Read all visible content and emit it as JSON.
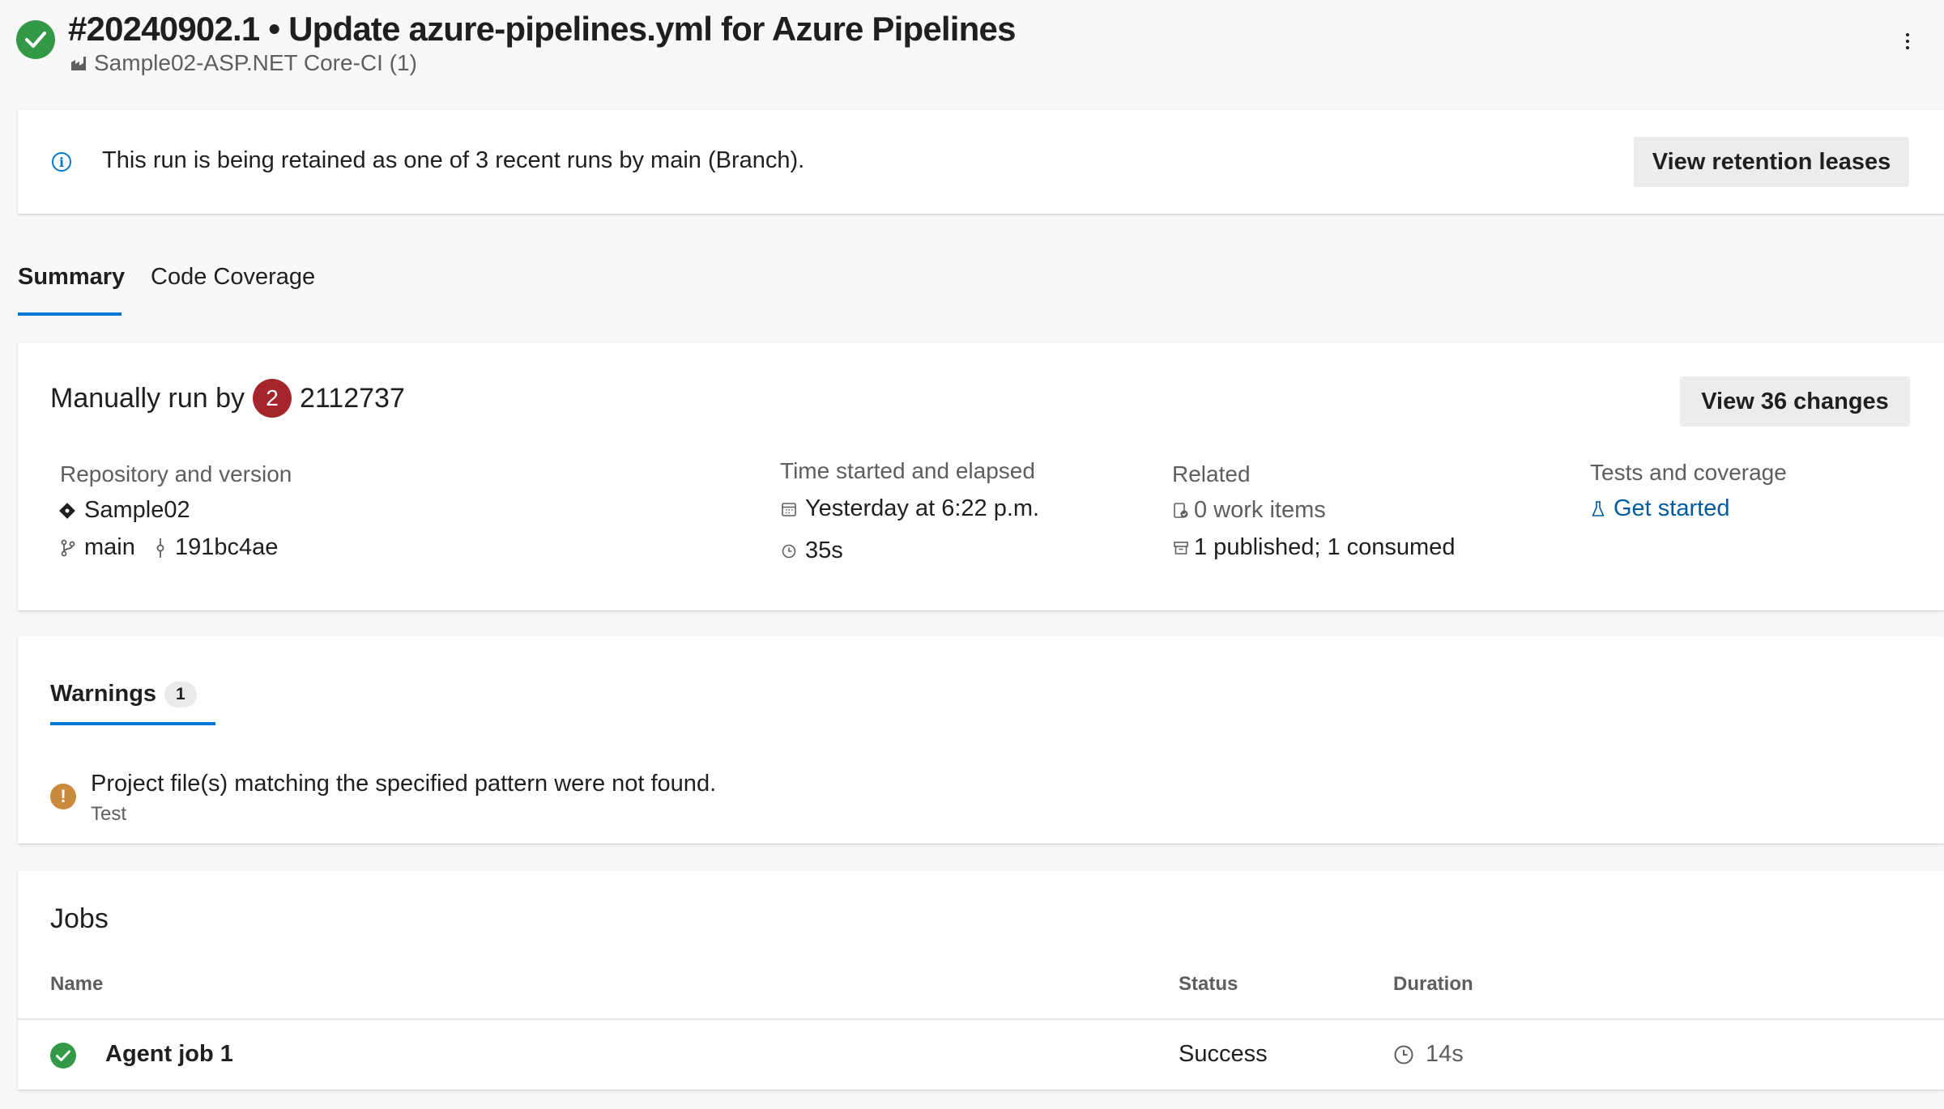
{
  "header": {
    "title": "#20240902.1 • Update azure-pipelines.yml for Azure Pipelines",
    "pipeline": "Sample02-ASP.NET Core-CI (1)",
    "status_icon": "success-check-icon",
    "more_icon": "more-actions-icon"
  },
  "retention": {
    "message": "This run is being retained as one of 3 recent runs by main (Branch).",
    "button_label": "View retention leases"
  },
  "tabs": [
    {
      "label": "Summary",
      "selected": true
    },
    {
      "label": "Code Coverage",
      "selected": false
    }
  ],
  "summary": {
    "run_by_prefix": "Manually run by",
    "avatar_initial": "2",
    "user": "2112737",
    "changes_button": "View 36 changes",
    "repository": {
      "label": "Repository and version",
      "repo": "Sample02",
      "branch": "main",
      "commit": "191bc4ae"
    },
    "time": {
      "label": "Time started and elapsed",
      "started": "Yesterday at 6:22 p.m.",
      "elapsed": "35s"
    },
    "related": {
      "label": "Related",
      "work_items": "0 work items",
      "artifacts": "1 published; 1 consumed"
    },
    "tests": {
      "label": "Tests and coverage",
      "link": "Get started"
    }
  },
  "warnings": {
    "tab_label": "Warnings",
    "count": "1",
    "items": [
      {
        "message": "Project file(s) matching the specified pattern were not found.",
        "source": "Test"
      }
    ]
  },
  "jobs": {
    "title": "Jobs",
    "columns": [
      "Name",
      "Status",
      "Duration"
    ],
    "rows": [
      {
        "name": "Agent job 1",
        "status": "Success",
        "duration": "14s"
      }
    ]
  },
  "colors": {
    "success": "#339947",
    "accent": "#0078d4",
    "link": "#005a9e",
    "warning": "#ca8a3c",
    "avatar": "#a4262c"
  }
}
